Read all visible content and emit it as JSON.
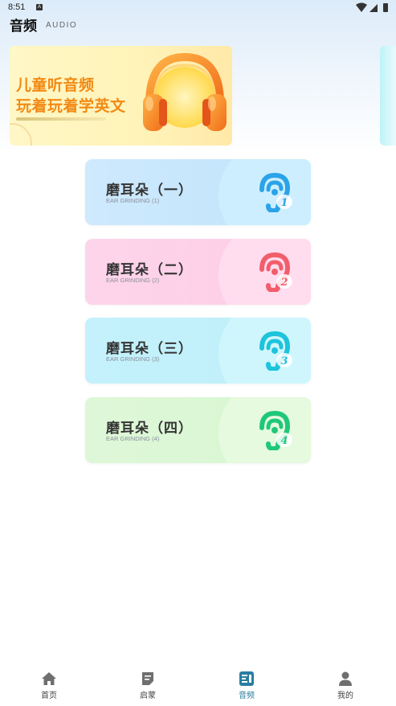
{
  "status_bar": {
    "time": "8:51",
    "notification_glyph": "A"
  },
  "header": {
    "title": "音频",
    "subtitle": "AUDIO"
  },
  "banner": {
    "line1": "儿童听音频",
    "line2": "玩着玩着学英文",
    "image": "headphones-icon"
  },
  "cards": [
    {
      "title": "磨耳朵（一）",
      "subtitle": "EAR GRINDING (1)",
      "badge": "1",
      "color": "#2aa3e8"
    },
    {
      "title": "磨耳朵（二）",
      "subtitle": "EAR GRINDING (2)",
      "badge": "2",
      "color": "#f25d6b"
    },
    {
      "title": "磨耳朵（三）",
      "subtitle": "EAR GRINDING (3)",
      "badge": "3",
      "color": "#1ec3dc"
    },
    {
      "title": "磨耳朵（四）",
      "subtitle": "EAR GRINDING (4)",
      "badge": "4",
      "color": "#1fc77c"
    }
  ],
  "bottom_nav": {
    "active": "音频",
    "items": [
      {
        "label": "首页",
        "icon": "home-icon"
      },
      {
        "label": "启蒙",
        "icon": "note-icon"
      },
      {
        "label": "音频",
        "icon": "audio-list-icon"
      },
      {
        "label": "我的",
        "icon": "user-icon"
      }
    ]
  }
}
